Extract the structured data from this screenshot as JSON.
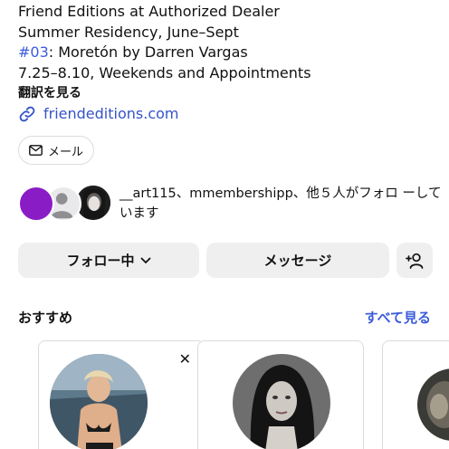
{
  "profile": {
    "bio_line1": "Friend Editions at Authorized Dealer",
    "bio_line2": "Summer Residency, June–Sept",
    "bio_hashtag": "#03",
    "bio_line3_rest": ": Moretón by Darren Vargas",
    "bio_line4": "7.25–8.10, Weekends and Appointments",
    "translate_label": "翻訳を見る",
    "website": "friendeditions.com",
    "mail_label": "メール"
  },
  "followed_by": {
    "text": "__art115、mmembershipp、他５人がフォロ ーしています"
  },
  "actions": {
    "following_label": "フォロー中",
    "message_label": "メッセージ",
    "add_icon": "add-person-icon"
  },
  "recommendations": {
    "title": "おすすめ",
    "see_all": "すべて見る"
  },
  "colors": {
    "link": "#3553c7",
    "accent": "#3b5bdb",
    "button_bg": "#efefef",
    "avatar_purple": "#8a1cc6"
  }
}
